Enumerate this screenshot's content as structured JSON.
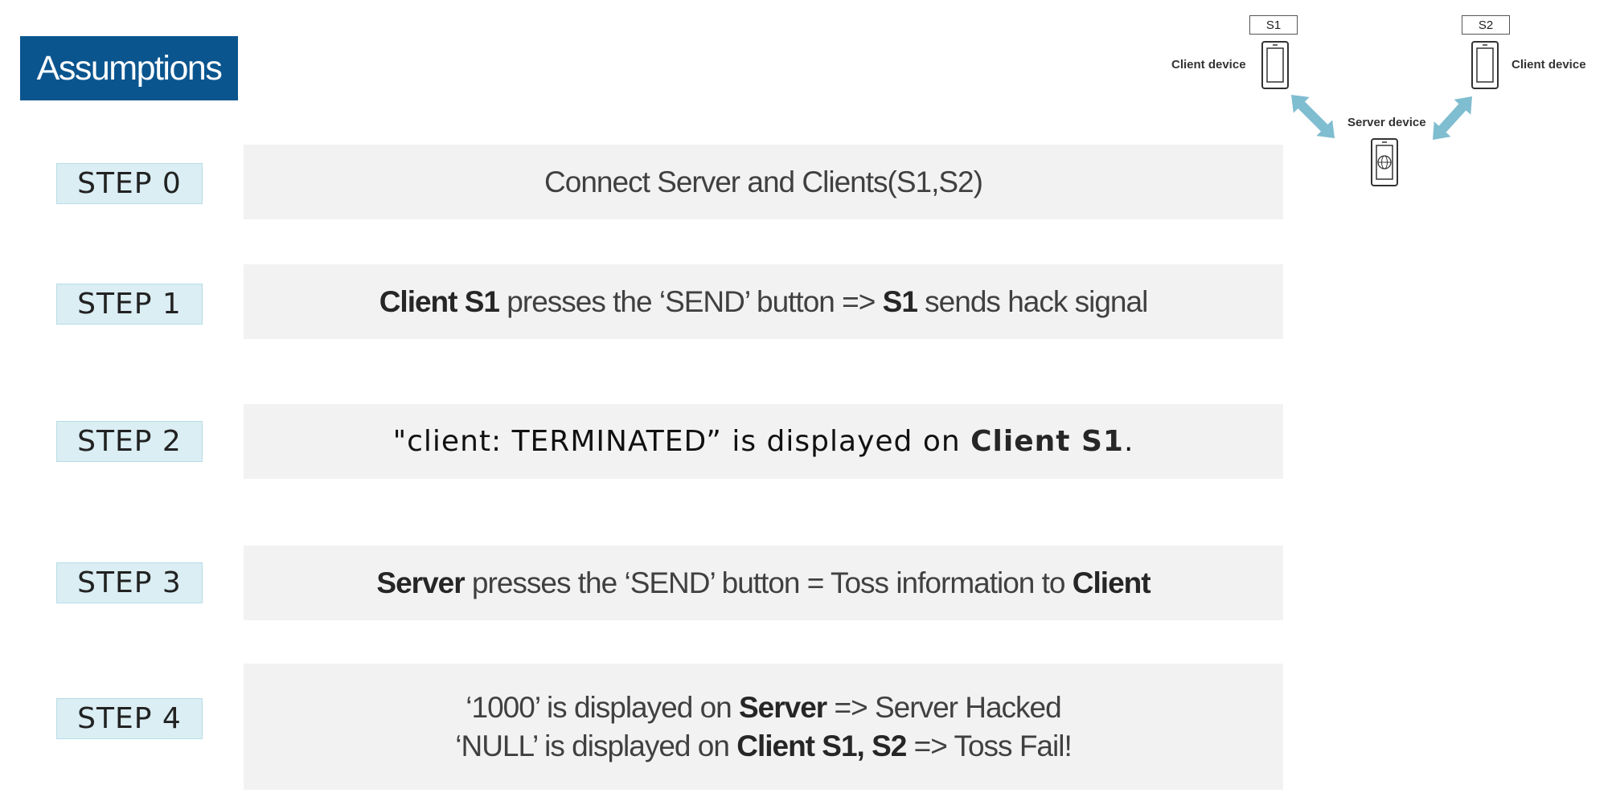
{
  "title": "Assumptions",
  "steps": [
    {
      "label": "STEP 0",
      "lines": [
        [
          {
            "t": "Connect Server and Clients(S1,S2)",
            "b": false
          }
        ]
      ]
    },
    {
      "label": "STEP 1",
      "lines": [
        [
          {
            "t": "Client S1",
            "b": true
          },
          {
            "t": " presses the ‘SEND’ button => ",
            "b": false
          },
          {
            "t": "S1",
            "b": true
          },
          {
            "t": " sends hack signal",
            "b": false
          }
        ]
      ]
    },
    {
      "label": "STEP 2",
      "lines": [
        [
          {
            "t": "\"client: TERMINATED” is displayed on ",
            "b": false
          },
          {
            "t": "Client S1",
            "b": true
          },
          {
            "t": ".",
            "b": false
          }
        ]
      ]
    },
    {
      "label": "STEP 3",
      "lines": [
        [
          {
            "t": "Server",
            "b": true
          },
          {
            "t": " presses the ‘SEND’ button = Toss information to ",
            "b": false
          },
          {
            "t": "Client",
            "b": true
          }
        ]
      ]
    },
    {
      "label": "STEP 4",
      "lines": [
        [
          {
            "t": "‘1000’ is displayed on ",
            "b": false
          },
          {
            "t": "Server",
            "b": true
          },
          {
            "t": " => Server Hacked",
            "b": false
          }
        ],
        [
          {
            "t": "‘NULL’ is displayed on ",
            "b": false
          },
          {
            "t": "Client S1, S2",
            "b": true
          },
          {
            "t": " => Toss Fail!",
            "b": false
          }
        ]
      ]
    }
  ],
  "diagram": {
    "client_left_tag": "S1",
    "client_right_tag": "S2",
    "client_left_label": "Client device",
    "client_right_label": "Client device",
    "server_label": "Server device",
    "arrow_color": "#7fbdd0",
    "icons": [
      "phone-icon",
      "phone-icon",
      "phone-globe-icon",
      "double-arrow-icon"
    ]
  },
  "colors": {
    "title_bg": "#0b558f",
    "step_label_bg": "#daeef3",
    "step_box_bg": "#f2f2f2"
  }
}
